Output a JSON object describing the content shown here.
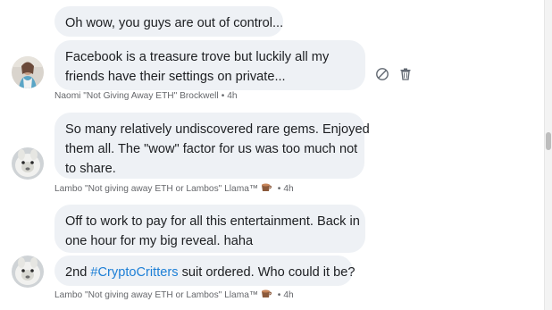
{
  "threads": [
    {
      "messages": [
        "Oh wow, you guys are out of control...",
        "Facebook is a treasure trove but luckily all my friends have their settings on private..."
      ],
      "message_lines": [
        [
          "Oh wow, you guys are out of control..."
        ],
        [
          "Facebook is a treasure trove but luckily all my",
          "friends have their settings on private..."
        ]
      ],
      "sender": "Naomi \"Not Giving Away ETH\" Brockwell",
      "time": "4h"
    },
    {
      "message_lines": [
        [
          "So many relatively undiscovered rare gems. Enjoyed",
          "them all. The \"wow\" factor for us was too much not",
          "to share."
        ]
      ],
      "sender": "Lambo \"Not giving away ETH or Lambos\" Llama™",
      "time": "4h"
    },
    {
      "message_lines": [
        [
          "Off to work to pay for all this entertainment. Back in",
          "one hour for my big reveal. haha"
        ]
      ],
      "hashtag_message": {
        "before": "2nd ",
        "hashtag": "#CryptoCritters",
        "after": " suit ordered. Who could it be?"
      },
      "sender": "Lambo \"Not giving away ETH or Lambos\" Llama™",
      "time": "4h"
    }
  ],
  "separator": "•",
  "icons": {
    "actions": [
      "hide-icon",
      "trash-icon"
    ],
    "sender_emoji": "coffee-cup-icon"
  },
  "colors": {
    "bubble": "#eef1f5",
    "hashtag": "#1d7fd6",
    "meta_text": "#65676b"
  }
}
